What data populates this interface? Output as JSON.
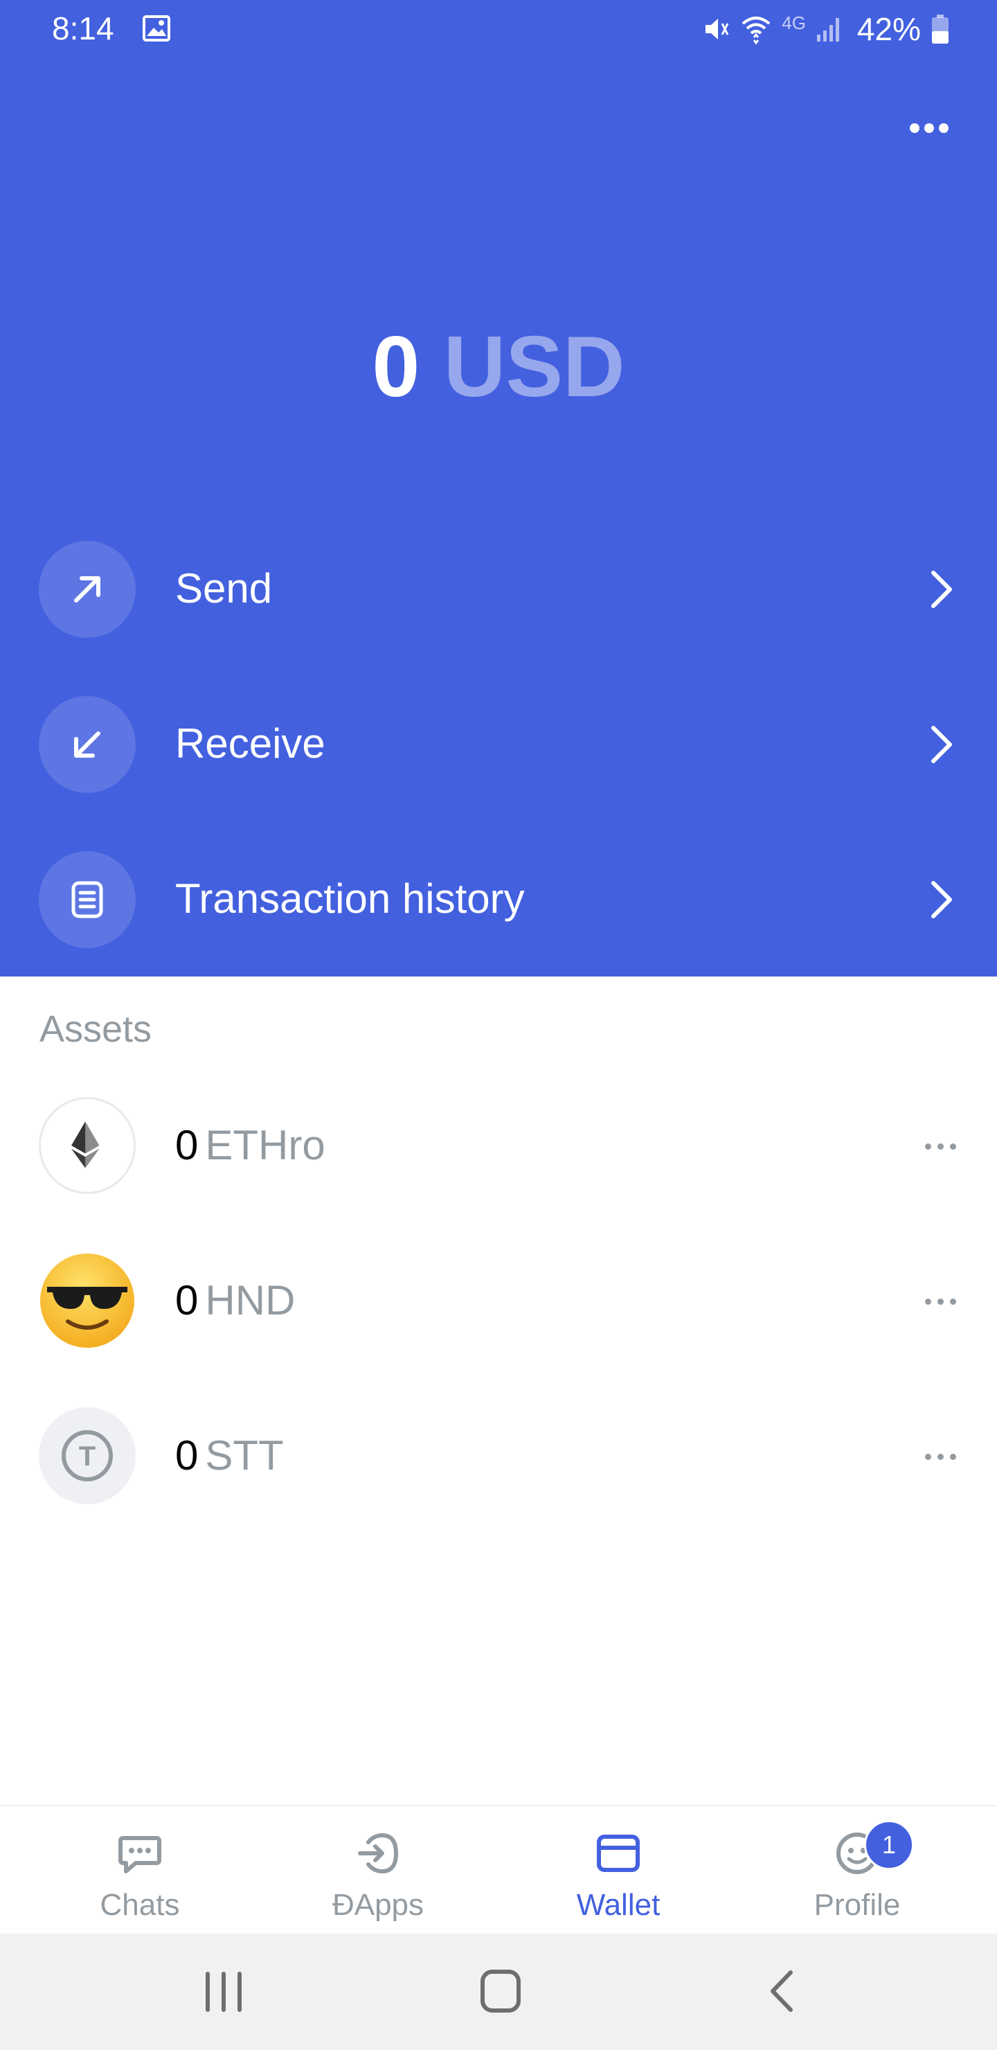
{
  "status_bar": {
    "time": "8:14",
    "battery_percent": "42%",
    "network_label": "4G"
  },
  "wallet": {
    "balance_amount": "0",
    "balance_currency": "USD"
  },
  "actions": [
    {
      "label": "Send",
      "icon": "arrow-up-right-icon"
    },
    {
      "label": "Receive",
      "icon": "arrow-down-left-icon"
    },
    {
      "label": "Transaction history",
      "icon": "document-list-icon"
    }
  ],
  "assets": {
    "title": "Assets",
    "items": [
      {
        "amount": "0",
        "symbol": "ETHro",
        "icon": "ethereum-icon"
      },
      {
        "amount": "0",
        "symbol": "HND",
        "icon": "sunglasses-emoji-icon"
      },
      {
        "amount": "0",
        "symbol": "STT",
        "icon": "status-token-icon",
        "icon_letter": "T"
      }
    ]
  },
  "tabs": [
    {
      "label": "Chats",
      "icon": "chat-icon",
      "active": false
    },
    {
      "label": "ÐApps",
      "icon": "dapps-icon",
      "active": false
    },
    {
      "label": "Wallet",
      "icon": "wallet-icon",
      "active": true
    },
    {
      "label": "Profile",
      "icon": "profile-icon",
      "active": false,
      "badge": "1"
    }
  ],
  "colors": {
    "accent": "#4360df",
    "muted_text": "#939ba1"
  }
}
